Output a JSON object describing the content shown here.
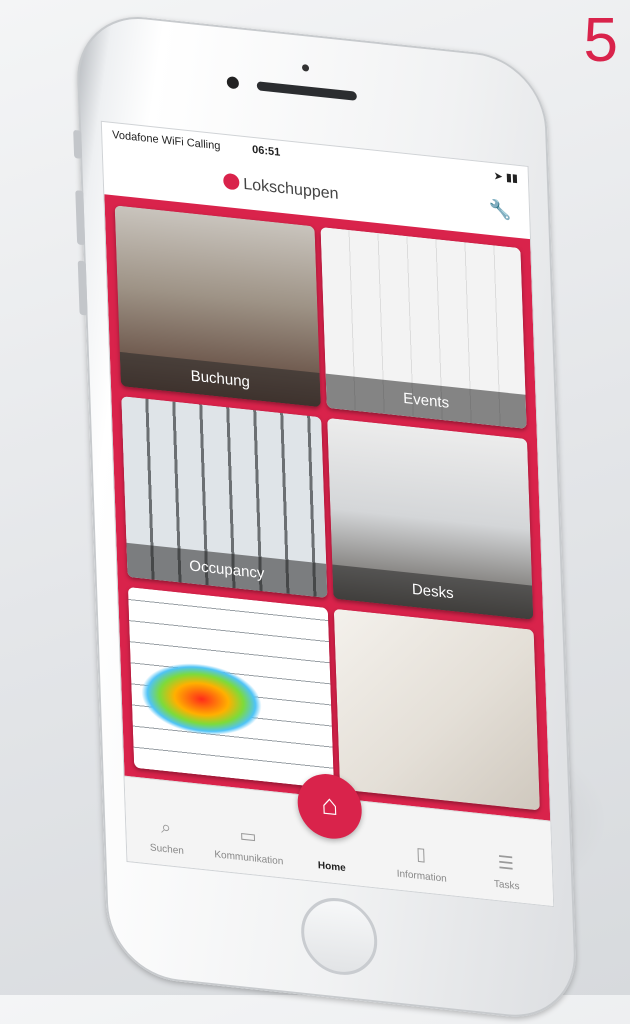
{
  "corner_number": "5",
  "status_bar": {
    "carrier": "Vodafone WiFi Calling",
    "time": "06:51"
  },
  "header": {
    "brand": "Lokschuppen",
    "settings_icon": "wrench-icon"
  },
  "tiles": [
    {
      "label": "Buchung"
    },
    {
      "label": "Events"
    },
    {
      "label": "Occupancy"
    },
    {
      "label": "Desks"
    },
    {
      "label": ""
    },
    {
      "label": ""
    }
  ],
  "tabbar": {
    "items": [
      {
        "label": "Suchen",
        "icon": "search-icon"
      },
      {
        "label": "Kommunikation",
        "icon": "chat-icon"
      },
      {
        "label": "Home",
        "icon": "home-icon"
      },
      {
        "label": "Information",
        "icon": "document-icon"
      },
      {
        "label": "Tasks",
        "icon": "list-icon"
      }
    ]
  },
  "colors": {
    "accent": "#d9234b"
  }
}
